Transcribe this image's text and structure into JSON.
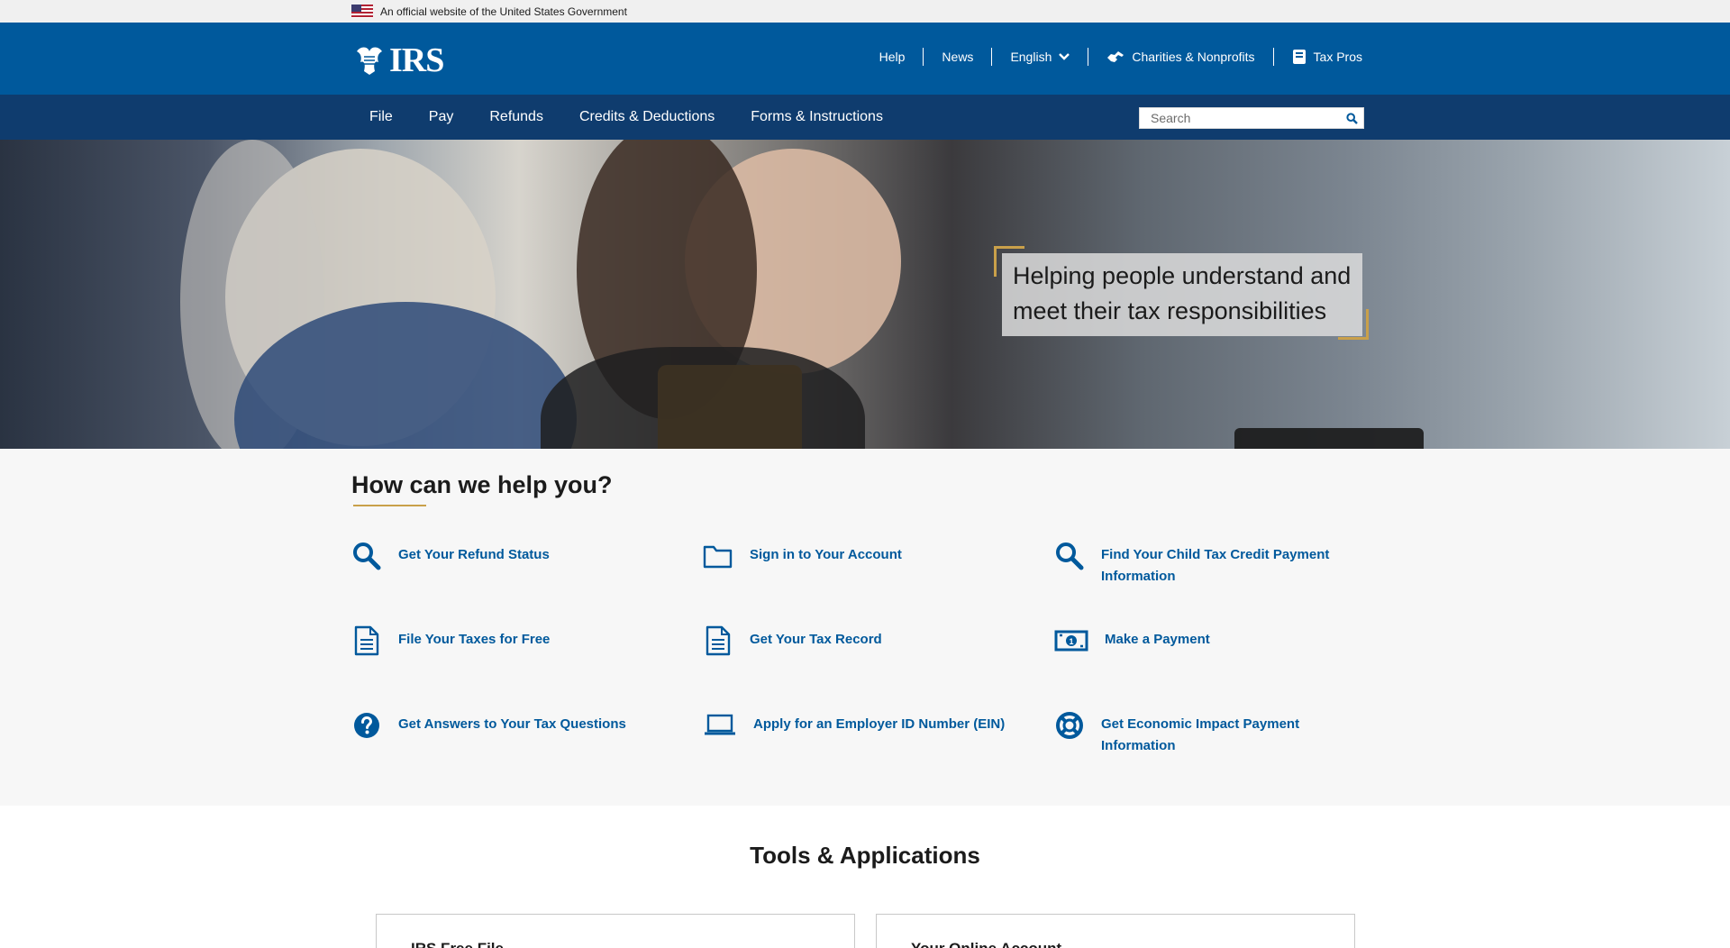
{
  "gov_banner": {
    "text": "An official website of the United States Government"
  },
  "header": {
    "logo_text": "IRS",
    "utility_links": [
      {
        "label": "Help",
        "icon": ""
      },
      {
        "label": "News",
        "icon": ""
      },
      {
        "label": "English",
        "icon": "chevron-down-icon"
      },
      {
        "label": "Charities & Nonprofits",
        "icon": "handshake-icon"
      },
      {
        "label": "Tax Pros",
        "icon": "tax-pros-icon"
      }
    ]
  },
  "main_nav": {
    "items": [
      "File",
      "Pay",
      "Refunds",
      "Credits & Deductions",
      "Forms & Instructions"
    ],
    "search_placeholder": "Search"
  },
  "hero": {
    "quote": "Helping people understand and meet their tax responsibilities"
  },
  "help": {
    "title": "How can we help you?",
    "links": [
      {
        "label": "Get Your Refund Status",
        "icon": "search-icon"
      },
      {
        "label": "Sign in to Your Account",
        "icon": "folder-icon"
      },
      {
        "label": "Find Your Child Tax Credit Payment Information",
        "icon": "search-icon"
      },
      {
        "label": "File Your Taxes for Free",
        "icon": "document-icon"
      },
      {
        "label": "Get Your Tax Record",
        "icon": "document-icon"
      },
      {
        "label": "Make a Payment",
        "icon": "money-icon"
      },
      {
        "label": "Get Answers to Your Tax Questions",
        "icon": "question-icon"
      },
      {
        "label": "Apply for an Employer ID Number (EIN)",
        "icon": "laptop-icon"
      },
      {
        "label": "Get Economic Impact Payment Information",
        "icon": "lifebuoy-icon"
      }
    ]
  },
  "tools": {
    "title": "Tools & Applications",
    "cards": [
      {
        "title": "IRS Free File"
      },
      {
        "title": "Your Online Account"
      }
    ]
  },
  "colors": {
    "header_blue": "#00599c",
    "nav_navy": "#0f3c6e",
    "link_blue": "#00599c",
    "accent_gold": "#c9a04a"
  }
}
